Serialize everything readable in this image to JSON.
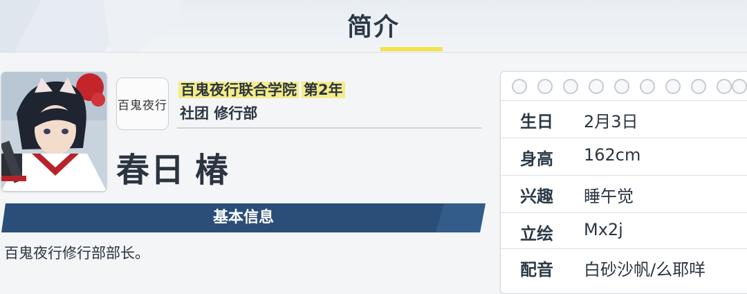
{
  "header": {
    "title": "简介"
  },
  "student": {
    "school": "百鬼夜行联合学院",
    "grade": "第2年",
    "club": "社团 修行部",
    "family_name": "春日",
    "given_name": "椿",
    "school_logo_text": "百鬼夜行"
  },
  "basic_info": {
    "label": "基本信息",
    "description": "百鬼夜行修行部部长。"
  },
  "profile": {
    "rows": [
      {
        "key": "生日",
        "value": "2月3日"
      },
      {
        "key": "身高",
        "value": "162cm"
      },
      {
        "key": "兴趣",
        "value": "睡午觉"
      },
      {
        "key": "立绘",
        "value": "Mx2j"
      },
      {
        "key": "配音",
        "value": "白砂沙帆/么耶咩"
      }
    ]
  },
  "colors": {
    "accent_yellow": "#f2e34b",
    "highlight": "#f4ec8a",
    "bar_navy": "#2a4e78",
    "text_dark": "#2b3440"
  }
}
